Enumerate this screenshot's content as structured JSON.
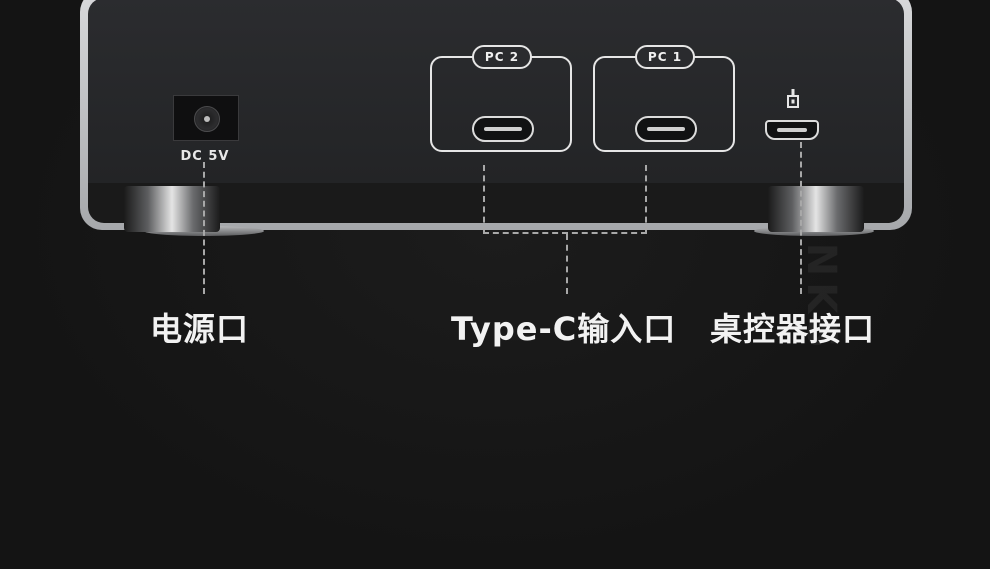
{
  "watermark": "优联 ULINKS",
  "device": {
    "dc_label": "DC 5V",
    "pc2_label": "PC 2",
    "pc1_label": "PC 1"
  },
  "labels": {
    "power": "电源口",
    "typec": "Type-C输入口",
    "controller": "桌控器接口"
  },
  "colors": {
    "background": "#141414",
    "panel": "#2b2c2f",
    "frame": "#c8c9cb",
    "outline": "#e6e6e6",
    "dash": "#a8a8a8"
  },
  "icons": {
    "controller_port": "controller-plug-icon"
  }
}
